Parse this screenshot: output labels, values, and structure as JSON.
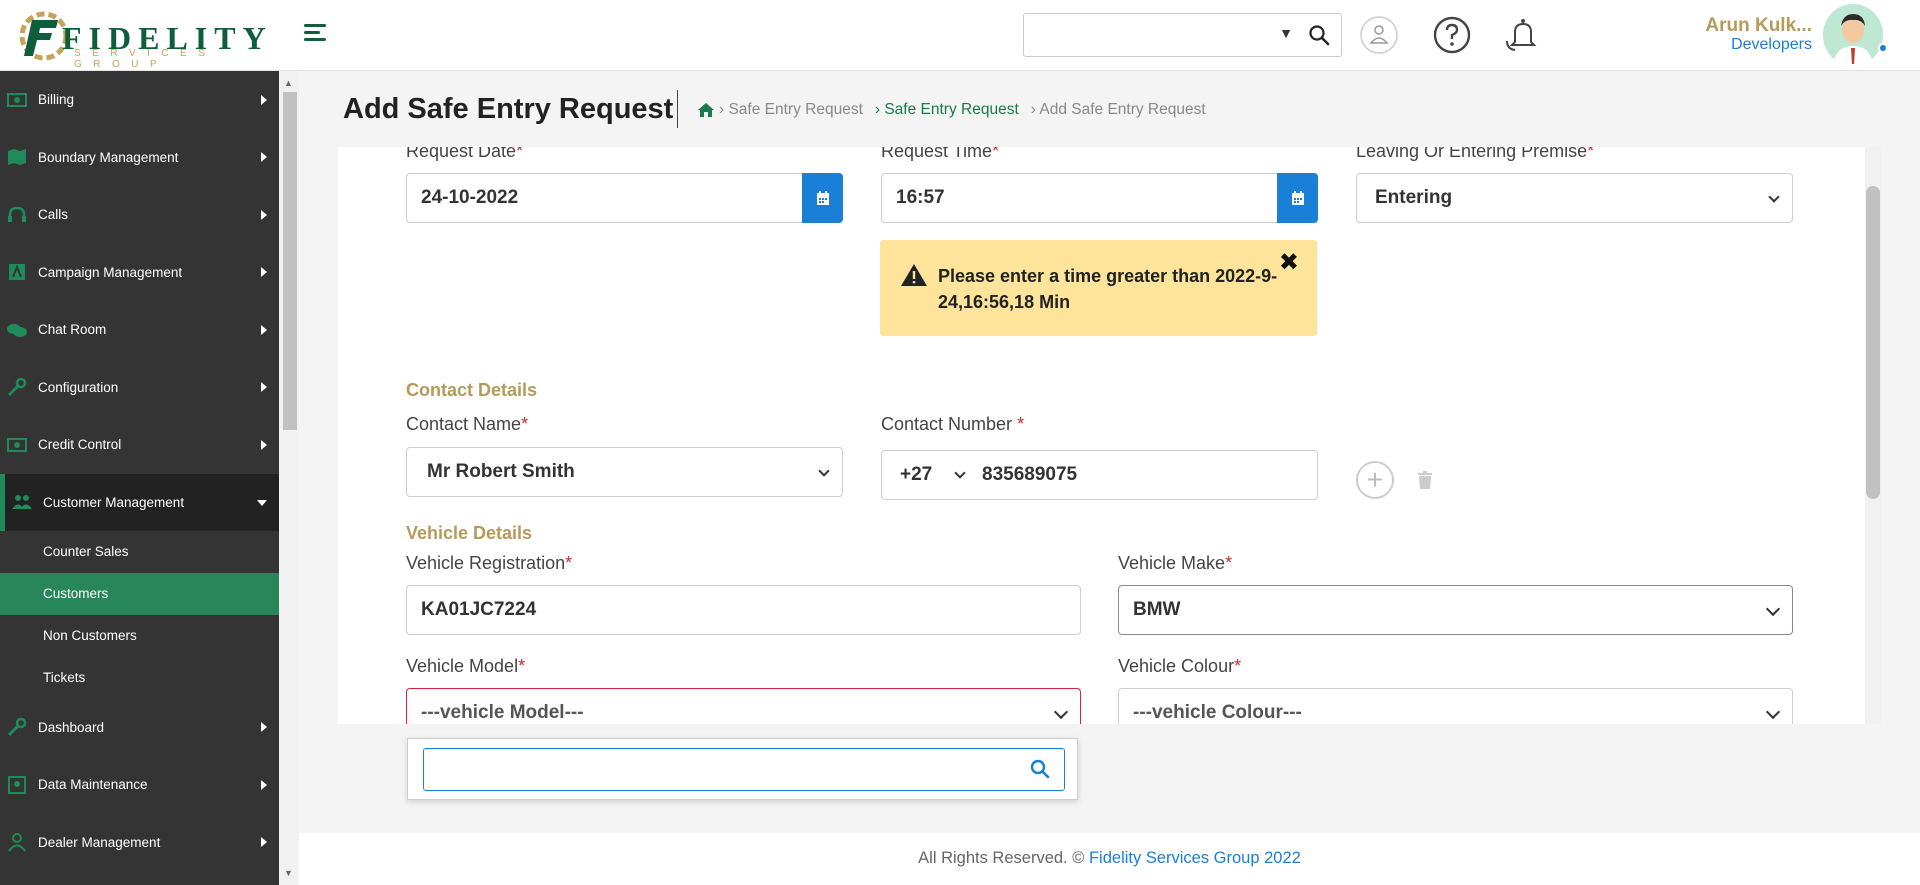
{
  "brand": {
    "name": "FIDELITY",
    "tagline": "SERVICES GROUP"
  },
  "header": {
    "search_caret": "▼",
    "user_name": "Arun Kulk...",
    "user_role": "Developers"
  },
  "sidebar": {
    "items_top": [
      {
        "label": "Billing",
        "icon": "billing-icon"
      },
      {
        "label": "Boundary Management",
        "icon": "map-icon"
      },
      {
        "label": "Calls",
        "icon": "headset-icon"
      },
      {
        "label": "Campaign Management",
        "icon": "campaign-icon"
      },
      {
        "label": "Chat Room",
        "icon": "chat-icon"
      },
      {
        "label": "Configuration",
        "icon": "wrench-icon"
      },
      {
        "label": "Credit Control",
        "icon": "money-icon"
      }
    ],
    "open_item": {
      "label": "Customer Management",
      "icon": "users-icon"
    },
    "sub_items": [
      {
        "label": "Counter Sales",
        "active": false
      },
      {
        "label": "Customers",
        "active": true
      },
      {
        "label": "Non Customers",
        "active": false
      },
      {
        "label": "Tickets",
        "active": false
      }
    ],
    "items_bottom": [
      {
        "label": "Dashboard",
        "icon": "wrench-icon"
      },
      {
        "label": "Data Maintenance",
        "icon": "data-icon"
      },
      {
        "label": "Dealer Management",
        "icon": "user-icon"
      }
    ]
  },
  "page": {
    "title": "Add Safe Entry Request",
    "breadcrumb": [
      "› Safe Entry Request",
      "› Safe Entry Request",
      "› Add Safe Entry Request"
    ]
  },
  "form": {
    "request_date": {
      "label": "Request Date",
      "value": "24-10-2022"
    },
    "request_time": {
      "label": "Request Time",
      "value": "16:57"
    },
    "premise": {
      "label": "Leaving Or Entering Premise",
      "value": "Entering"
    },
    "alert": {
      "text": "Please enter a time greater than 2022-9-24,16:56,18 Min",
      "close": "✖"
    },
    "contact_section": "Contact Details",
    "contact_name": {
      "label": "Contact Name",
      "value": "Mr Robert Smith"
    },
    "contact_number": {
      "label": "Contact Number ",
      "code": "+27",
      "value": "835689075"
    },
    "add_button": "+",
    "vehicle_section": "Vehicle Details",
    "vehicle_registration": {
      "label": "Vehicle Registration",
      "value": "KA01JC7224"
    },
    "vehicle_make": {
      "label": "Vehicle Make",
      "value": "BMW"
    },
    "vehicle_model": {
      "label": "Vehicle Model",
      "value": "---vehicle Model---"
    },
    "vehicle_colour": {
      "label": "Vehicle Colour",
      "value": "---vehicle Colour---"
    },
    "required_mark": "*",
    "dropdown_search_value": ""
  },
  "footer": {
    "text": "All Rights Reserved. © ",
    "link": "Fidelity Services Group 2022"
  },
  "colors": {
    "brand_green": "#0e5d3b",
    "gold": "#b59a5a",
    "blue": "#1a7fd6",
    "alert": "#fde49a",
    "error_red": "#d6243a"
  }
}
